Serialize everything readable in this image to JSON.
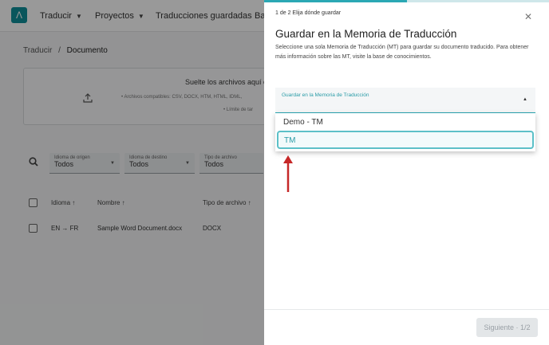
{
  "app": {
    "logo": "Λ",
    "nav": [
      {
        "label": "Traducir"
      },
      {
        "label": "Proyectos"
      },
      {
        "label": "Traducciones guardadas"
      },
      {
        "label": "Ba"
      }
    ],
    "breadcrumb": {
      "parent": "Traducir",
      "sep": "/",
      "current": "Documento"
    },
    "dropzone": {
      "title": "Suelte los archivos aquí o h",
      "formats": "Archivos compatibles: CSV, DOCX, HTM, HTML, IDML,",
      "limit": "Límite de tar"
    },
    "filters": [
      {
        "label": "Idioma de origen",
        "value": "Todos"
      },
      {
        "label": "Idioma de destino",
        "value": "Todos"
      },
      {
        "label": "Tipo de archivo",
        "value": "Todos"
      }
    ],
    "table": {
      "headers": {
        "lang": "Idioma",
        "name": "Nombre",
        "type": "Tipo de archivo"
      },
      "rows": [
        {
          "src": "EN",
          "arrow": "→",
          "tgt": "FR",
          "name": "Sample Word Document.docx",
          "type": "DOCX"
        }
      ]
    }
  },
  "modal": {
    "step": "1 de 2 Elija dónde guardar",
    "progress": 0.5,
    "title": "Guardar en la Memoria de Traducción",
    "description": "Seleccione una sola Memoria de Traducción (MT) para guardar su documento traducido. Para obtener más información sobre las MT, visite la base de conocimientos.",
    "select_label": "Guardar en la Memoria de Traducción",
    "options": [
      "Demo - TM",
      "TM"
    ],
    "next_button": "Siguiente · 1/2"
  },
  "colors": {
    "accent": "#2ba8b4",
    "arrow": "#c62828"
  }
}
